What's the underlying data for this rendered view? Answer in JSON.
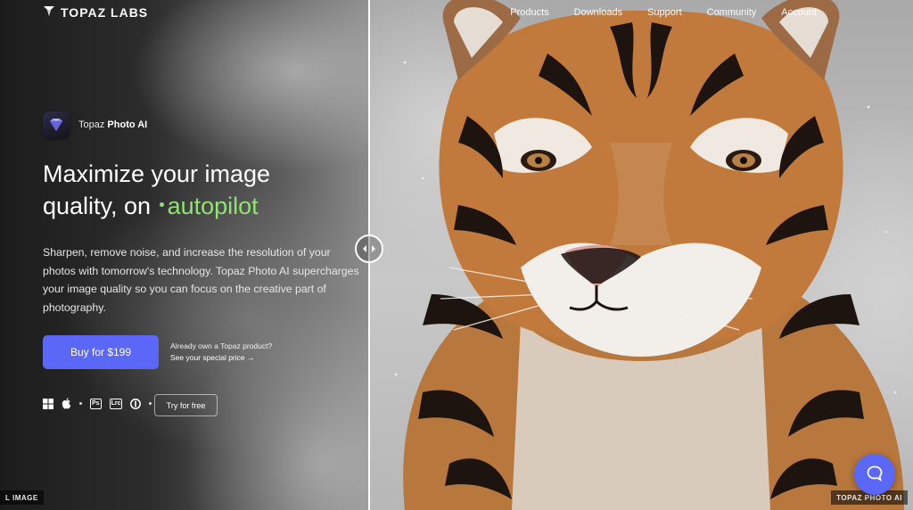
{
  "brand": {
    "logo_text": "TOPAZ LABS"
  },
  "nav": {
    "items": [
      "Products",
      "Downloads",
      "Support",
      "Community",
      "Account"
    ]
  },
  "product": {
    "vendor": "Topaz",
    "name": "Photo AI"
  },
  "hero": {
    "headline_line1": "Maximize your image",
    "headline_line2_prefix": "quality, on",
    "headline_accent": "autopilot",
    "description": "Sharpen, remove noise, and increase the resolution of your photos with tomorrow's technology. Topaz Photo AI supercharges your image quality so you can focus on the creative part of photography."
  },
  "cta": {
    "buy_label": "Buy for $199",
    "owner_question": "Already own a Topaz product?",
    "owner_link": "See your special price →",
    "try_free_label": "Try for free"
  },
  "platforms": {
    "icons": [
      "windows-icon",
      "apple-icon",
      "photoshop-plugin-icon",
      "lightroom-plugin-icon",
      "info-icon"
    ],
    "ps_label": "Ps",
    "lrc_label": "Lrc"
  },
  "compare": {
    "left_label": "L IMAGE",
    "right_label": "TOPAZ PHOTO AI"
  },
  "colors": {
    "accent_green": "#8fe371",
    "button_blue": "#5b67f6"
  }
}
